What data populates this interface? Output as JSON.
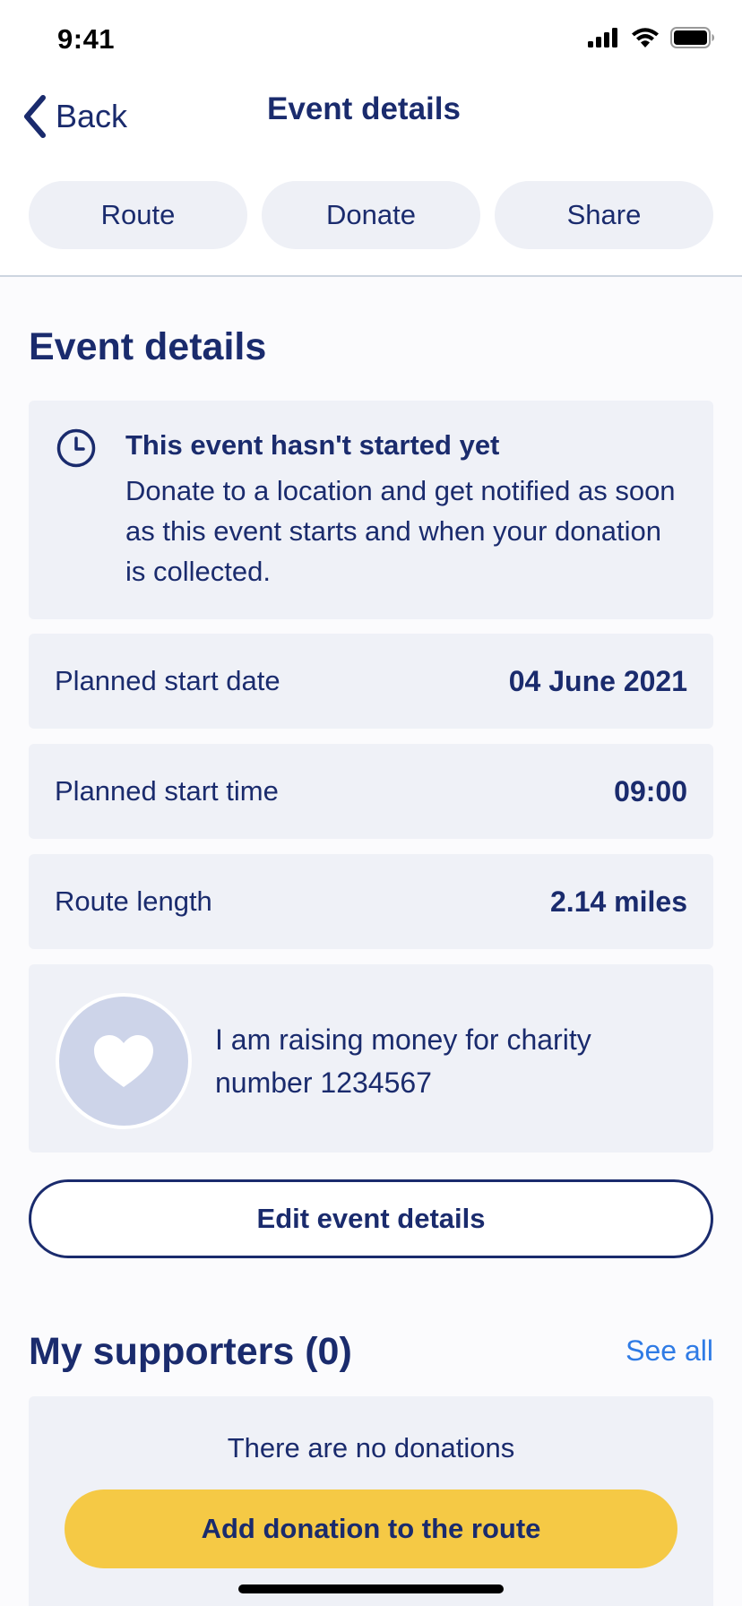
{
  "status_bar": {
    "time": "9:41",
    "icons": [
      "signal-icon",
      "wifi-icon",
      "battery-icon"
    ]
  },
  "nav": {
    "back_label": "Back",
    "title": "Event details"
  },
  "actions": {
    "route": "Route",
    "donate": "Donate",
    "share": "Share"
  },
  "event_details": {
    "heading": "Event details",
    "notice": {
      "icon": "clock-icon",
      "title": "This event hasn't started yet",
      "body": "Donate to a location and get notified as soon as this event starts and when your donation is collected."
    },
    "rows": [
      {
        "label": "Planned start date",
        "value": "04 June 2021"
      },
      {
        "label": "Planned start time",
        "value": "09:00"
      },
      {
        "label": "Route length",
        "value": "2.14 miles"
      }
    ],
    "charity": {
      "icon": "heart-icon",
      "text": "I am raising money for charity number 1234567"
    },
    "edit_button": "Edit event details"
  },
  "supporters": {
    "heading": "My supporters (0)",
    "see_all": "See all",
    "empty_text": "There are no donations",
    "add_button": "Add donation to the route"
  },
  "colors": {
    "navy": "#1a2b6d",
    "card_bg": "#eff1f7",
    "accent_yellow": "#f5c945",
    "link_blue": "#2f7be5"
  }
}
